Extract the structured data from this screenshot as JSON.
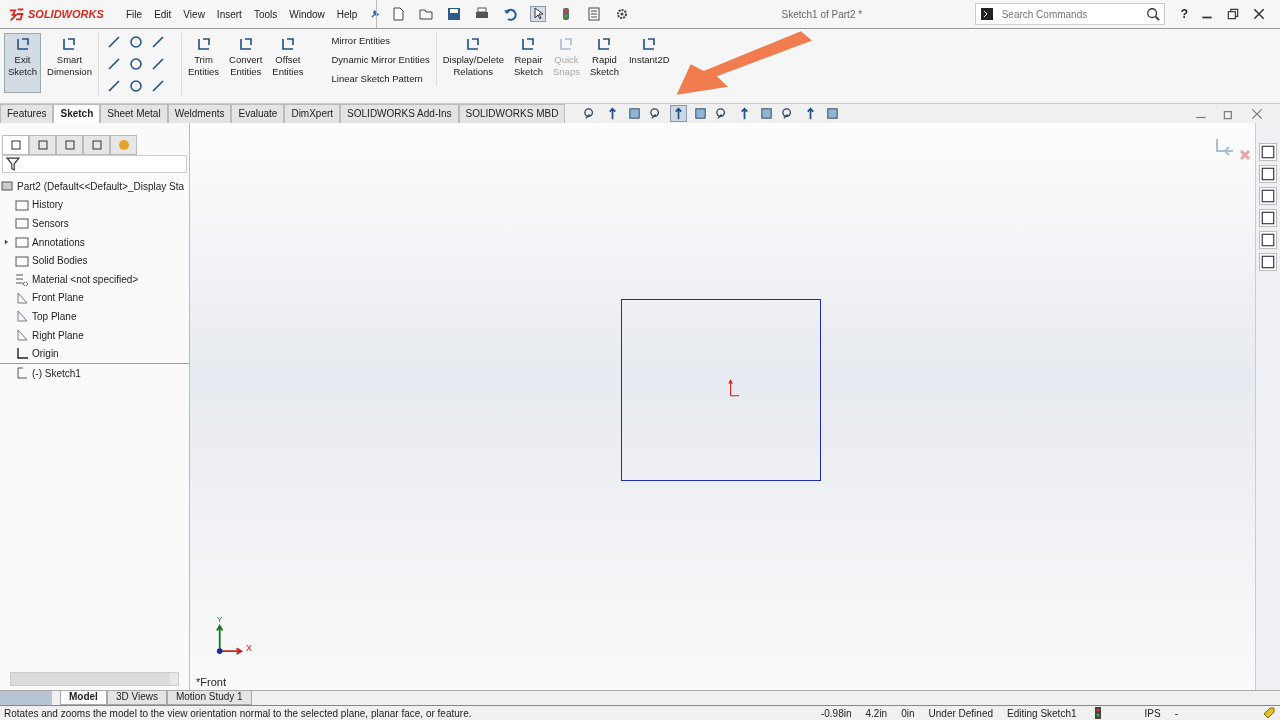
{
  "app": {
    "logo": "SOLIDWORKS"
  },
  "menu": [
    "File",
    "Edit",
    "View",
    "Insert",
    "Tools",
    "Window",
    "Help"
  ],
  "window": {
    "title": "Sketch1 of Part2 *"
  },
  "search": {
    "placeholder": "Search Commands"
  },
  "help": "?",
  "ribbon": [
    {
      "kind": "large",
      "label": "Exit Sketch",
      "selected": true,
      "disabled": false
    },
    {
      "kind": "large",
      "label": "Smart Dimension",
      "selected": false,
      "disabled": false
    },
    {
      "kind": "grid"
    },
    {
      "kind": "large",
      "label": "Trim Entities",
      "selected": false,
      "disabled": false
    },
    {
      "kind": "large",
      "label": "Convert Entities",
      "selected": false,
      "disabled": false
    },
    {
      "kind": "large",
      "label": "Offset Entities",
      "selected": false,
      "disabled": false
    },
    {
      "kind": "list",
      "items": [
        "Mirror Entities",
        "Dynamic Mirror Entities",
        "Linear Sketch Pattern"
      ]
    },
    {
      "kind": "large",
      "label": "Display/Delete Relations",
      "selected": false,
      "disabled": false
    },
    {
      "kind": "large",
      "label": "Repair Sketch",
      "selected": false,
      "disabled": false
    },
    {
      "kind": "large",
      "label": "Quick Snaps",
      "selected": false,
      "disabled": true
    },
    {
      "kind": "large",
      "label": "Rapid Sketch",
      "selected": false,
      "disabled": false
    },
    {
      "kind": "large",
      "label": "Instant2D",
      "selected": false,
      "disabled": false
    }
  ],
  "tabs": [
    {
      "label": "Features",
      "selected": false
    },
    {
      "label": "Sketch",
      "selected": true
    },
    {
      "label": "Sheet Metal",
      "selected": false
    },
    {
      "label": "Weldments",
      "selected": false
    },
    {
      "label": "Evaluate",
      "selected": false
    },
    {
      "label": "DimXpert",
      "selected": false
    },
    {
      "label": "SOLIDWORKS Add-Ins",
      "selected": false
    },
    {
      "label": "SOLIDWORKS MBD",
      "selected": false
    }
  ],
  "view_tools": [
    {
      "selected": false
    },
    {
      "selected": false
    },
    {
      "selected": false
    },
    {
      "selected": false
    },
    {
      "selected": true
    },
    {
      "selected": false
    },
    {
      "selected": false
    },
    {
      "selected": false
    },
    {
      "selected": false
    },
    {
      "selected": false
    },
    {
      "selected": false
    },
    {
      "selected": false
    }
  ],
  "panel_tabs": [
    {
      "selected": true
    },
    {
      "selected": false
    },
    {
      "selected": false
    },
    {
      "selected": false
    },
    {
      "selected": false
    }
  ],
  "tree": {
    "root": "Part2  (Default<<Default>_Display Sta",
    "children": [
      {
        "kind": "folder",
        "label": "History",
        "collapsed": false
      },
      {
        "kind": "folder",
        "label": "Sensors",
        "collapsed": false
      },
      {
        "kind": "folder",
        "label": "Annotations",
        "collapsed": true
      },
      {
        "kind": "folder",
        "label": "Solid Bodies",
        "collapsed": false
      },
      {
        "kind": "material",
        "label": "Material <not specified>",
        "collapsed": false
      },
      {
        "kind": "plane",
        "label": "Front Plane",
        "collapsed": false
      },
      {
        "kind": "plane",
        "label": "Top Plane",
        "collapsed": false
      },
      {
        "kind": "plane",
        "label": "Right Plane",
        "collapsed": false
      },
      {
        "kind": "origin",
        "label": "Origin",
        "collapsed": false
      },
      {
        "kind": "sketch",
        "label": "(-) Sketch1",
        "collapsed": false
      }
    ]
  },
  "viewport": {
    "axis_y": "Y",
    "axis_x": "X",
    "view_name": "*Front"
  },
  "bottom_tabs": [
    {
      "label": "Model",
      "selected": true
    },
    {
      "label": "3D Views",
      "selected": false
    },
    {
      "label": "Motion Study 1",
      "selected": false
    }
  ],
  "status_bar": {
    "message": "Rotates and zooms the model to the view orientation normal to the selected plane, planar face, or feature.",
    "fields": [
      "-0.98in",
      "4.2in",
      "0in",
      "Under Defined",
      "Editing Sketch1"
    ],
    "units": "IPS",
    "extra": "-"
  }
}
